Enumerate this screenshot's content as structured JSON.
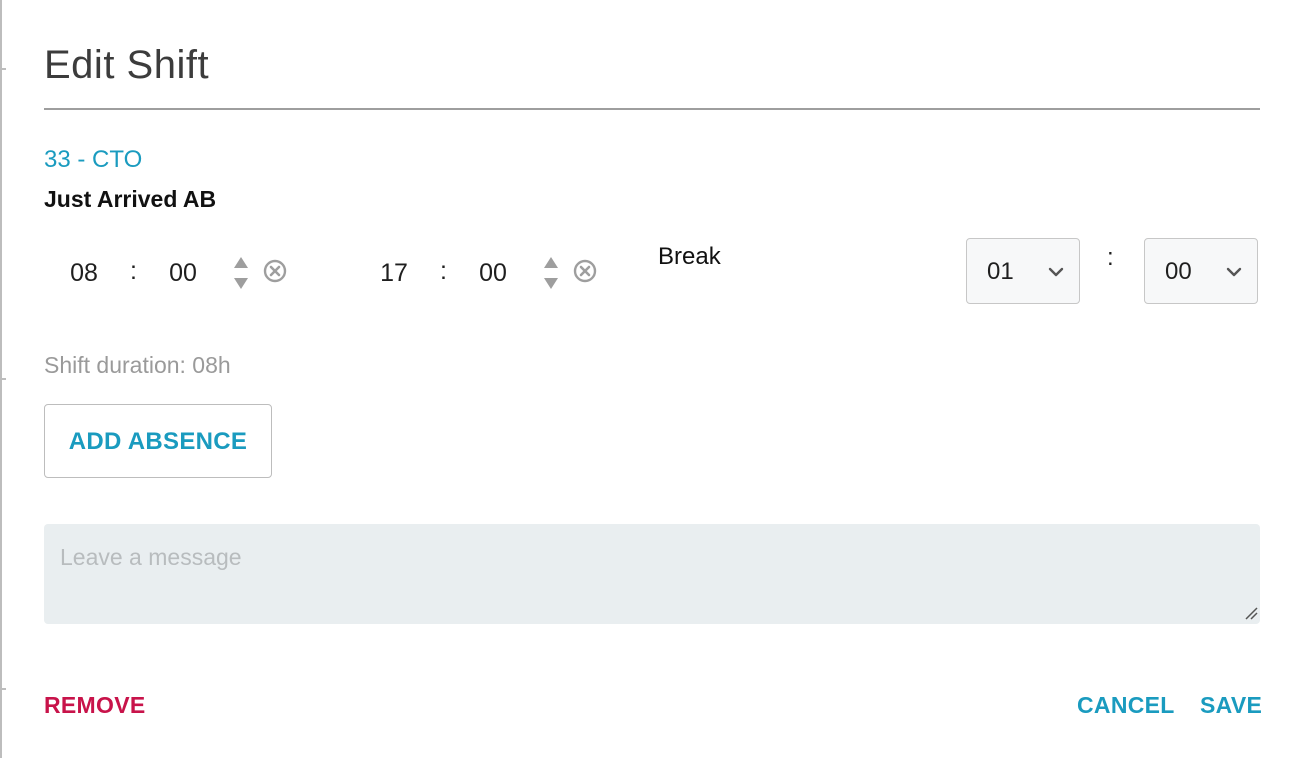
{
  "dialog": {
    "title": "Edit Shift"
  },
  "employee": {
    "id_label": "33 - CTO",
    "name": "Just Arrived AB"
  },
  "shift": {
    "start": {
      "hours": "08",
      "separator": ":",
      "minutes": "00"
    },
    "end": {
      "hours": "17",
      "separator": ":",
      "minutes": "00"
    }
  },
  "break": {
    "label": "Break",
    "hours": "01",
    "separator": ":",
    "minutes": "00"
  },
  "duration_text": "Shift duration: 08h",
  "add_absence_label": "ADD ABSENCE",
  "message": {
    "placeholder": "Leave a message",
    "value": ""
  },
  "actions": {
    "remove_label": "REMOVE",
    "cancel_label": "CANCEL",
    "save_label": "SAVE"
  },
  "colors": {
    "accent": "#1a9bbf",
    "danger": "#c8134a",
    "muted": "#9a9a9a",
    "message_bg": "#e9eef0"
  },
  "icons": {
    "spinner": "spinner-arrows-icon",
    "clear": "clear-circle-x-icon",
    "chevron": "chevron-down-icon",
    "resize": "resize-grip-icon"
  }
}
